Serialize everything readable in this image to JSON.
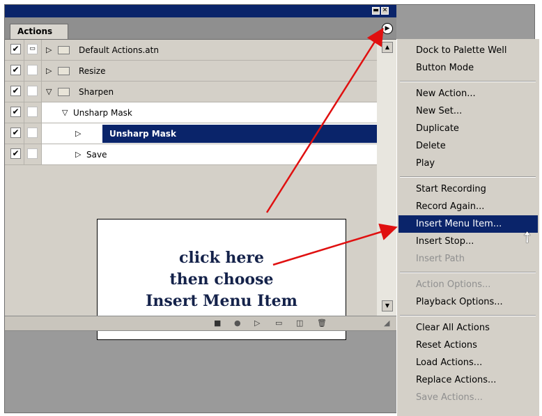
{
  "palette": {
    "tab_label": "Actions",
    "minimize_glyph": "▬",
    "close_glyph": "✕",
    "menu_button_glyph": "▶"
  },
  "rows": [
    {
      "label": "Default Actions.atn",
      "checked": true,
      "dialog": true,
      "kind": "set",
      "expanded": false
    },
    {
      "label": "Resize",
      "checked": true,
      "dialog": false,
      "kind": "set",
      "expanded": false
    },
    {
      "label": "Sharpen",
      "checked": true,
      "dialog": false,
      "kind": "set",
      "expanded": true
    },
    {
      "label": "Unsharp Mask",
      "checked": true,
      "dialog": false,
      "kind": "action",
      "expanded": true
    },
    {
      "label": "Unsharp Mask",
      "checked": true,
      "dialog": false,
      "kind": "step",
      "selected": true
    },
    {
      "label": "Save",
      "checked": true,
      "dialog": false,
      "kind": "step"
    }
  ],
  "callout": {
    "line1": "click here",
    "line2": "then choose",
    "line3": "Insert Menu Item"
  },
  "toolbar_icons": [
    "stop-icon",
    "record-icon",
    "play-icon",
    "new-set-icon",
    "new-action-icon",
    "trash-icon"
  ],
  "menu": {
    "groups": [
      [
        {
          "label": "Dock to Palette Well",
          "enabled": true
        },
        {
          "label": "Button Mode",
          "enabled": true
        }
      ],
      [
        {
          "label": "New Action...",
          "enabled": true
        },
        {
          "label": "New Set...",
          "enabled": true
        },
        {
          "label": "Duplicate",
          "enabled": true
        },
        {
          "label": "Delete",
          "enabled": true
        },
        {
          "label": "Play",
          "enabled": true
        }
      ],
      [
        {
          "label": "Start Recording",
          "enabled": true
        },
        {
          "label": "Record Again...",
          "enabled": true
        },
        {
          "label": "Insert Menu Item...",
          "enabled": true,
          "highlighted": true
        },
        {
          "label": "Insert Stop...",
          "enabled": true
        },
        {
          "label": "Insert Path",
          "enabled": false
        }
      ],
      [
        {
          "label": "Action Options...",
          "enabled": false
        },
        {
          "label": "Playback Options...",
          "enabled": true
        }
      ],
      [
        {
          "label": "Clear All Actions",
          "enabled": true
        },
        {
          "label": "Reset Actions",
          "enabled": true
        },
        {
          "label": "Load Actions...",
          "enabled": true
        },
        {
          "label": "Replace Actions...",
          "enabled": true
        },
        {
          "label": "Save Actions...",
          "enabled": false
        }
      ]
    ]
  },
  "colors": {
    "title_bar": "#0a246a",
    "selection": "#0a246a",
    "arrow": "#e01010",
    "callout_text": "#14224a"
  }
}
